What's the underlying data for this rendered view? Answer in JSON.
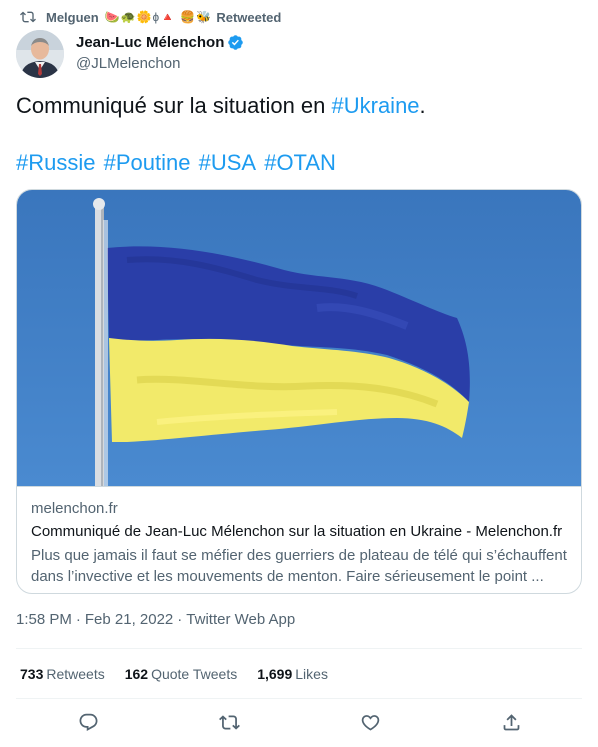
{
  "retweet": {
    "user": "Melguen",
    "emojis": "🍉🐢🌼ɸ🔺 🍔🐝",
    "label": "Retweeted"
  },
  "author": {
    "display_name": "Jean-Luc Mélenchon",
    "handle": "@JLMelenchon",
    "verified": true
  },
  "tweet": {
    "text_before": "Communiqué sur la situation en ",
    "text_tag": "#Ukraine",
    "text_after": ".",
    "hashtags": [
      "#Russie",
      "#Poutine",
      "#USA",
      "#OTAN"
    ]
  },
  "card": {
    "domain": "melenchon.fr",
    "title": "Communiqué de Jean-Luc Mélenchon sur la situation en Ukraine - Melenchon.fr",
    "description": "Plus que jamais il faut se méfier des guerriers de plateau de télé qui s’échauffent dans l’invective et les mouvements de menton. Faire sérieusement le point ..."
  },
  "meta": {
    "time": "1:58 PM",
    "separator": "·",
    "date": "Feb 21, 2022",
    "source": "Twitter Web App"
  },
  "stats": {
    "retweets_count": "733",
    "retweets_label": "Retweets",
    "quotes_count": "162",
    "quotes_label": "Quote Tweets",
    "likes_count": "1,699",
    "likes_label": "Likes"
  },
  "colors": {
    "link": "#1d9bf0",
    "secondary_text": "#536471",
    "flag_blue": "#2a3ea8",
    "flag_yellow": "#f2ea6a",
    "sky": "#3f7ec1"
  },
  "icons": [
    "retweet-icon",
    "verified-badge-icon",
    "reply-icon",
    "like-icon",
    "share-icon"
  ]
}
